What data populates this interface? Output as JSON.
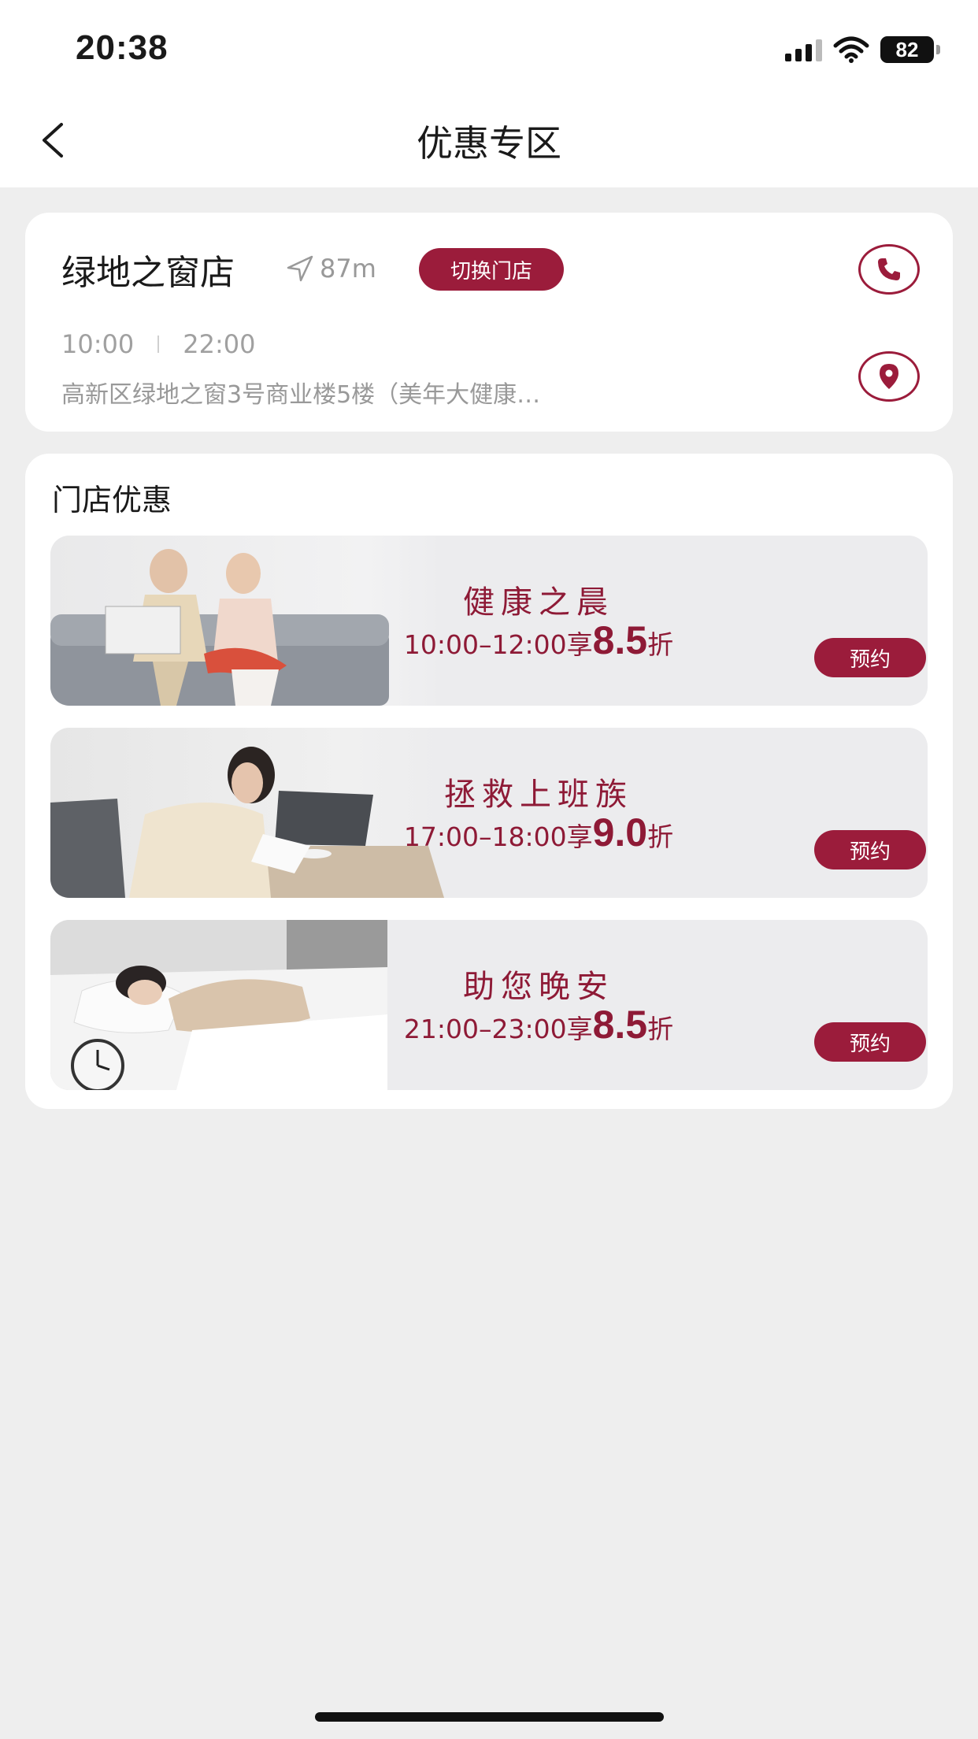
{
  "status": {
    "time": "20:38",
    "battery": "82"
  },
  "nav": {
    "title": "优惠专区"
  },
  "store": {
    "name": "绿地之窗店",
    "distance": "87m",
    "switch_label": "切换门店",
    "open_time": "10:00",
    "close_time": "22:00",
    "address": "高新区绿地之窗3号商业楼5楼（美年大健康…"
  },
  "promotions": {
    "section_title": "门店优惠",
    "items": [
      {
        "name": "健康之晨",
        "time_prefix": "10:00–12:00享",
        "rate": "8.5",
        "unit": "折",
        "book_label": "预约"
      },
      {
        "name": "拯救上班族",
        "time_prefix": "17:00–18:00享",
        "rate": "9.0",
        "unit": "折",
        "book_label": "预约"
      },
      {
        "name": "助您晚安",
        "time_prefix": "21:00–23:00享",
        "rate": "8.5",
        "unit": "折",
        "book_label": "预约"
      }
    ]
  },
  "colors": {
    "accent": "#9b1c3b",
    "accent_text": "#8e1a36",
    "background": "#eeeeee"
  },
  "icons": [
    "back-arrow-icon",
    "navigation-arrow-icon",
    "phone-icon",
    "location-pin-icon",
    "signal-icon",
    "wifi-icon",
    "battery-icon"
  ]
}
